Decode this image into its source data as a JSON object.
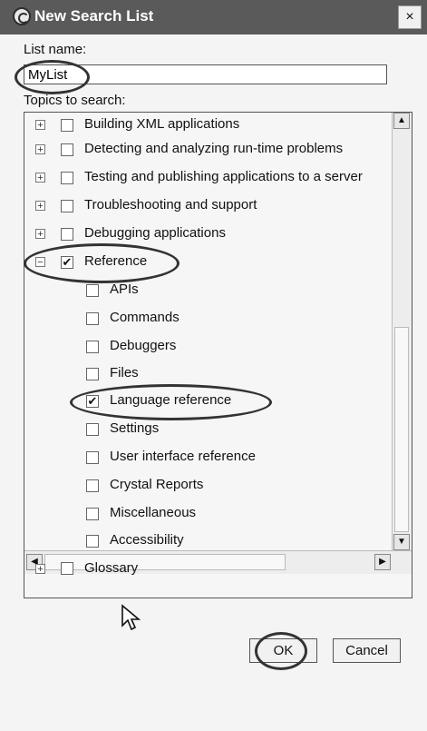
{
  "window": {
    "title": "New Search List",
    "close_glyph": "×",
    "app_icon": "eclipse-app-icon"
  },
  "form": {
    "list_name_label": "List name:",
    "list_name_value": "MyList",
    "topics_label": "Topics to search:"
  },
  "tree": {
    "items": [
      {
        "label": "Building XML applications",
        "checked": false,
        "expander": "+"
      },
      {
        "label": "Detecting and analyzing run-time problems",
        "checked": false,
        "expander": "+"
      },
      {
        "label": "Testing and publishing applications to a server",
        "checked": false,
        "expander": "+"
      },
      {
        "label": "Troubleshooting and support",
        "checked": false,
        "expander": "+"
      },
      {
        "label": "Debugging applications",
        "checked": false,
        "expander": "+"
      },
      {
        "label": "Reference",
        "checked": true,
        "expander": "−"
      },
      {
        "label": "APIs",
        "checked": false
      },
      {
        "label": "Commands",
        "checked": false
      },
      {
        "label": "Debuggers",
        "checked": false
      },
      {
        "label": "Files",
        "checked": false
      },
      {
        "label": "Language reference",
        "checked": true
      },
      {
        "label": "Settings",
        "checked": false
      },
      {
        "label": "User interface reference",
        "checked": false
      },
      {
        "label": "Crystal Reports",
        "checked": false
      },
      {
        "label": "Miscellaneous",
        "checked": false
      },
      {
        "label": "Accessibility",
        "checked": false
      },
      {
        "label": "Glossary",
        "checked": false,
        "expander": "+"
      }
    ],
    "check_glyph": "✔",
    "scroll_up_glyph": "▲",
    "scroll_down_glyph": "▼",
    "scroll_left_glyph": "◀",
    "scroll_right_glyph": "▶"
  },
  "buttons": {
    "ok": "OK",
    "cancel": "Cancel"
  },
  "colors": {
    "titlebar": "#5a5a5a",
    "highlight_ring": "#333333"
  }
}
